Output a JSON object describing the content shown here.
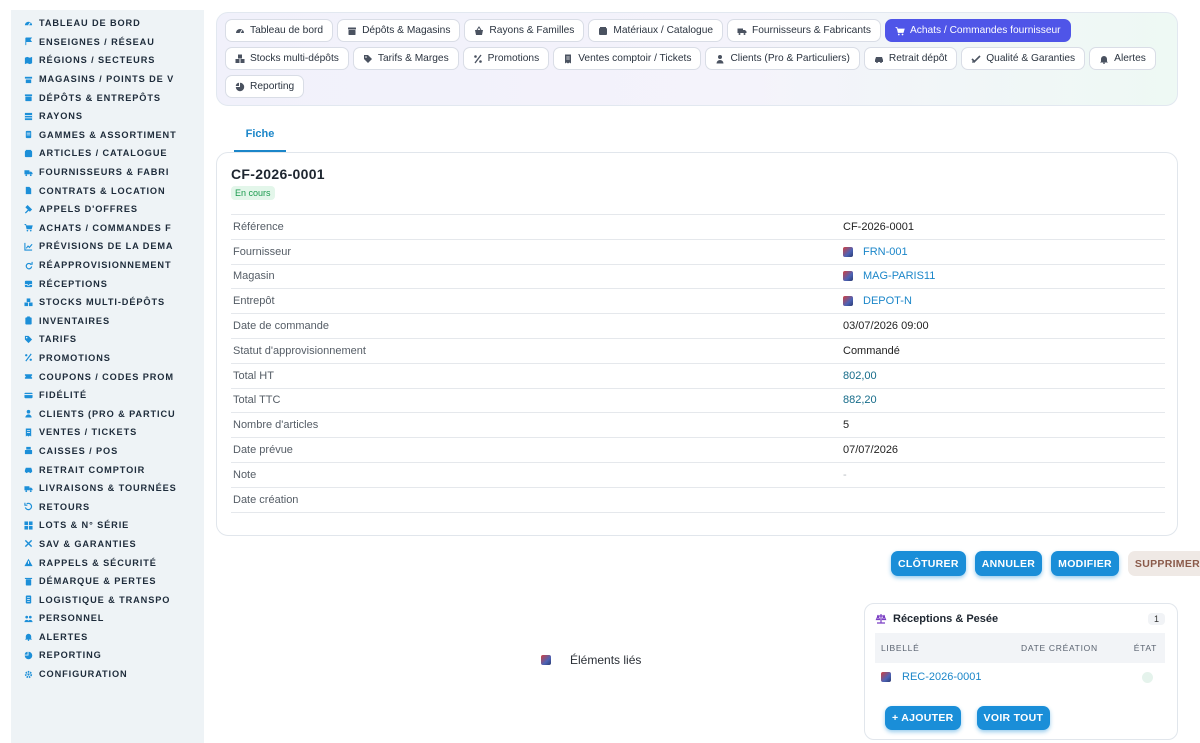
{
  "sidebar": {
    "items": [
      {
        "label": "TABLEAU DE BORD",
        "icon": "dashboard-icon"
      },
      {
        "label": "ENSEIGNES / RÉSEAU",
        "icon": "flag-icon"
      },
      {
        "label": "RÉGIONS / SECTEURS",
        "icon": "map-icon"
      },
      {
        "label": "MAGASINS / POINTS DE V",
        "icon": "store-icon"
      },
      {
        "label": "DÉPÔTS & ENTREPÔTS",
        "icon": "warehouse-icon"
      },
      {
        "label": "RAYONS",
        "icon": "shelf-icon"
      },
      {
        "label": "GAMMES & ASSORTIMENT",
        "icon": "list-icon"
      },
      {
        "label": "ARTICLES / CATALOGUE",
        "icon": "catalog-icon"
      },
      {
        "label": "FOURNISSEURS & FABRI",
        "icon": "truck-icon"
      },
      {
        "label": "CONTRATS & LOCATION",
        "icon": "document-icon"
      },
      {
        "label": "APPELS D'OFFRES",
        "icon": "gavel-icon"
      },
      {
        "label": "ACHATS / COMMANDES F",
        "icon": "cart-icon"
      },
      {
        "label": "PRÉVISIONS DE LA DEMA",
        "icon": "chart-icon"
      },
      {
        "label": "RÉAPPROVISIONNEMENT",
        "icon": "refresh-icon"
      },
      {
        "label": "RÉCEPTIONS",
        "icon": "inbox-icon"
      },
      {
        "label": "STOCKS MULTI-DÉPÔTS",
        "icon": "boxes-icon"
      },
      {
        "label": "INVENTAIRES",
        "icon": "clipboard-icon"
      },
      {
        "label": "TARIFS",
        "icon": "tag-icon"
      },
      {
        "label": "PROMOTIONS",
        "icon": "percent-icon"
      },
      {
        "label": "COUPONS / CODES PROM",
        "icon": "ticket-icon"
      },
      {
        "label": "FIDÉLITÉ",
        "icon": "card-icon"
      },
      {
        "label": "CLIENTS (PRO & PARTICU",
        "icon": "user-icon"
      },
      {
        "label": "VENTES / TICKETS",
        "icon": "receipt-icon"
      },
      {
        "label": "CAISSES / POS",
        "icon": "cash-register-icon"
      },
      {
        "label": "RETRAIT COMPTOIR",
        "icon": "car-icon"
      },
      {
        "label": "LIVRAISONS & TOURNÉES",
        "icon": "delivery-icon"
      },
      {
        "label": "RETOURS",
        "icon": "return-icon"
      },
      {
        "label": "LOTS & N° SÉRIE",
        "icon": "barcode-icon"
      },
      {
        "label": "SAV & GARANTIES",
        "icon": "tools-icon"
      },
      {
        "label": "RAPPELS & SÉCURITÉ",
        "icon": "warning-icon"
      },
      {
        "label": "DÉMARQUE & PERTES",
        "icon": "trash-icon"
      },
      {
        "label": "LOGISTIQUE & TRANSPO",
        "icon": "route-icon"
      },
      {
        "label": "PERSONNEL",
        "icon": "people-icon"
      },
      {
        "label": "ALERTES",
        "icon": "bell-icon"
      },
      {
        "label": "REPORTING",
        "icon": "pie-chart-icon"
      },
      {
        "label": "CONFIGURATION",
        "icon": "gear-icon"
      }
    ]
  },
  "tabs": {
    "items": [
      {
        "label": "Tableau de bord",
        "icon": "dashboard-icon",
        "active": false
      },
      {
        "label": "Dépôts & Magasins",
        "icon": "warehouse-icon",
        "active": false
      },
      {
        "label": "Rayons & Familles",
        "icon": "basket-icon",
        "active": false
      },
      {
        "label": "Matériaux / Catalogue",
        "icon": "catalog-icon",
        "active": false
      },
      {
        "label": "Fournisseurs & Fabricants",
        "icon": "truck-icon",
        "active": false
      },
      {
        "label": "Achats / Commandes fournisseur",
        "icon": "cart-icon",
        "active": true
      },
      {
        "label": "Stocks multi-dépôts",
        "icon": "boxes-icon",
        "active": false
      },
      {
        "label": "Tarifs & Marges",
        "icon": "tag-icon",
        "active": false
      },
      {
        "label": "Promotions",
        "icon": "percent-icon",
        "active": false
      },
      {
        "label": "Ventes comptoir / Tickets",
        "icon": "receipt-icon",
        "active": false
      },
      {
        "label": "Clients (Pro & Particuliers)",
        "icon": "user-icon",
        "active": false
      },
      {
        "label": "Retrait dépôt",
        "icon": "car-icon",
        "active": false
      },
      {
        "label": "Qualité & Garanties",
        "icon": "check-icon",
        "active": false
      },
      {
        "label": "Alertes",
        "icon": "bell-icon",
        "active": false
      },
      {
        "label": "Reporting",
        "icon": "pie-chart-icon",
        "active": false
      }
    ]
  },
  "subtabs": {
    "fiche": "Fiche"
  },
  "record": {
    "title": "CF-2026-0001",
    "status": "En cours",
    "fields": [
      {
        "label": "Référence",
        "value": "CF-2026-0001",
        "kind": "text"
      },
      {
        "label": "Fournisseur",
        "value": "FRN-001",
        "kind": "link"
      },
      {
        "label": "Magasin",
        "value": "MAG-PARIS11",
        "kind": "link"
      },
      {
        "label": "Entrepôt",
        "value": "DEPOT-N",
        "kind": "link"
      },
      {
        "label": "Date de commande",
        "value": "03/07/2026 09:00",
        "kind": "text"
      },
      {
        "label": "Statut d'approvisionnement",
        "value": "Commandé",
        "kind": "text"
      },
      {
        "label": "Total HT",
        "value": "802,00",
        "kind": "num"
      },
      {
        "label": "Total TTC",
        "value": "882,20",
        "kind": "num"
      },
      {
        "label": "Nombre d'articles",
        "value": "5",
        "kind": "text"
      },
      {
        "label": "Date prévue",
        "value": "07/07/2026",
        "kind": "text"
      },
      {
        "label": "Note",
        "value": "-",
        "kind": "muted"
      },
      {
        "label": "Date création",
        "value": "",
        "kind": "text"
      }
    ]
  },
  "actions": {
    "cloturer": "CLÔTURER",
    "annuler": "ANNULER",
    "modifier": "MODIFIER",
    "supprimer": "SUPPRIMER"
  },
  "linked": {
    "label": "Éléments liés"
  },
  "receptions": {
    "title": "Réceptions & Pesée",
    "count": "1",
    "columns": {
      "libelle": "LIBELLÉ",
      "date": "DATE CRÉATION",
      "etat": "ÉTAT"
    },
    "rows": [
      {
        "libelle": "REC-2026-0001",
        "date": "",
        "etat": ""
      }
    ],
    "add": "+ AJOUTER",
    "see_all": "VOIR TOUT"
  },
  "colors": {
    "accent": "#1a8ed8",
    "active_tab": "#4f55e8",
    "status_green": "#1a9a4d"
  }
}
